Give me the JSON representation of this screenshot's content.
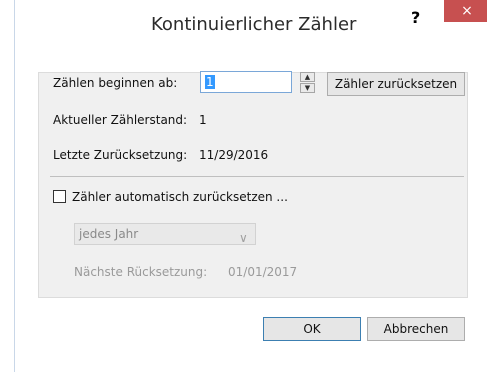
{
  "dialog": {
    "title": "Kontinuierlicher Zähler",
    "help_label": "?",
    "close_label": "×"
  },
  "counter": {
    "start_label": "Zählen beginnen ab:",
    "start_value": "1",
    "reset_button": "Zähler zurücksetzen",
    "current_label": "Aktueller Zählerstand:",
    "current_value": "1",
    "last_reset_label": "Letzte Zurücksetzung:",
    "last_reset_value": "11/29/2016"
  },
  "auto_reset": {
    "checkbox_label": "Zähler automatisch zurücksetzen ...",
    "checked": false,
    "interval_selected": "jedes Jahr",
    "next_reset_label": "Nächste Rücksetzung:",
    "next_reset_value": "01/01/2017"
  },
  "footer": {
    "ok_label": "OK",
    "cancel_label": "Abbrechen"
  }
}
